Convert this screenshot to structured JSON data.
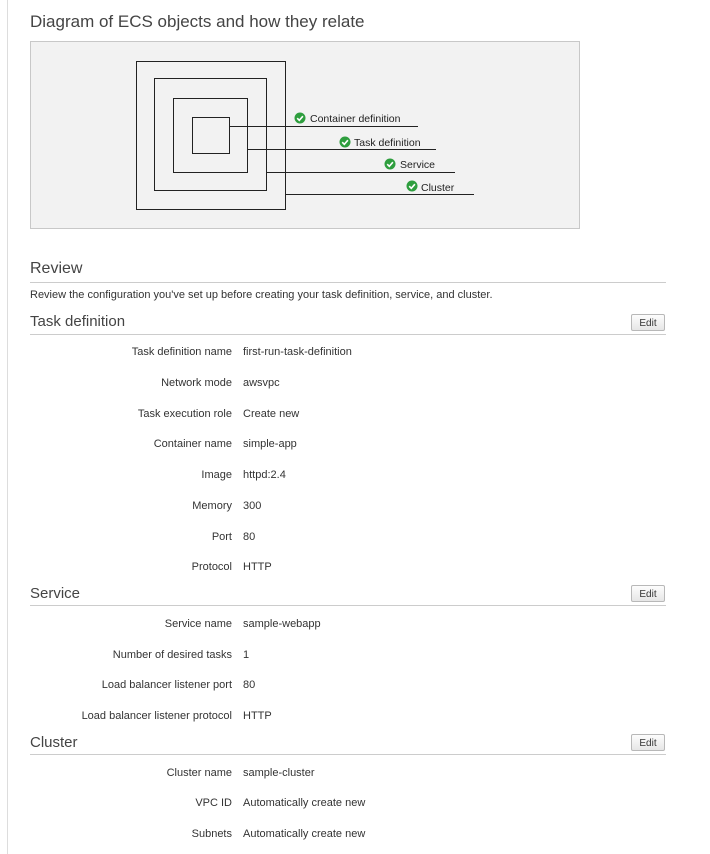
{
  "diagram": {
    "title": "Diagram of ECS objects and how they relate",
    "labels": [
      "Container definition",
      "Task definition",
      "Service",
      "Cluster"
    ],
    "status_icon": "check-circle-icon",
    "status_color": "#2e9e3e"
  },
  "review": {
    "title": "Review",
    "description": "Review the configuration you've set up before creating your task definition, service, and cluster.",
    "sections": [
      {
        "title": "Task definition",
        "edit_label": "Edit",
        "rows": [
          {
            "label": "Task definition name",
            "value": "first-run-task-definition"
          },
          {
            "label": "Network mode",
            "value": "awsvpc"
          },
          {
            "label": "Task execution role",
            "value": "Create new"
          },
          {
            "label": "Container name",
            "value": "simple-app"
          },
          {
            "label": "Image",
            "value": "httpd:2.4"
          },
          {
            "label": "Memory",
            "value": "300"
          },
          {
            "label": "Port",
            "value": "80"
          },
          {
            "label": "Protocol",
            "value": "HTTP"
          }
        ]
      },
      {
        "title": "Service",
        "edit_label": "Edit",
        "rows": [
          {
            "label": "Service name",
            "value": "sample-webapp"
          },
          {
            "label": "Number of desired tasks",
            "value": "1"
          },
          {
            "label": "Load balancer listener port",
            "value": "80"
          },
          {
            "label": "Load balancer listener protocol",
            "value": "HTTP"
          }
        ]
      },
      {
        "title": "Cluster",
        "edit_label": "Edit",
        "rows": [
          {
            "label": "Cluster name",
            "value": "sample-cluster"
          },
          {
            "label": "VPC ID",
            "value": "Automatically create new"
          },
          {
            "label": "Subnets",
            "value": "Automatically create new"
          }
        ]
      }
    ]
  }
}
